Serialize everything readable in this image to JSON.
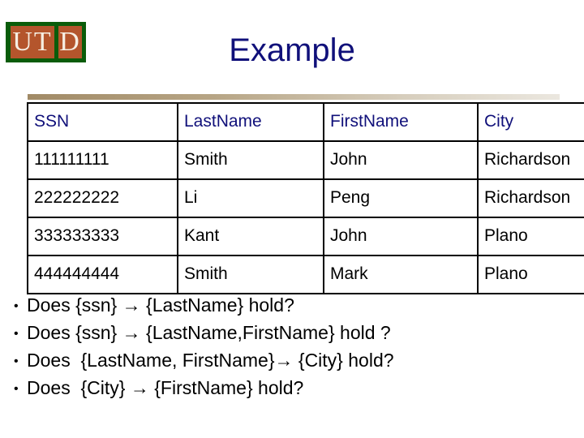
{
  "logo": {
    "name": "utd-logo",
    "tiles": [
      {
        "text": "U T",
        "letters": [
          "U",
          "T"
        ]
      },
      {
        "text": "D",
        "letters": [
          "D"
        ]
      }
    ],
    "letter_u": "U",
    "letter_t": "T",
    "letter_d": "D",
    "frame_color": "#0a5c0a",
    "tile_color": "#b4552c",
    "letter_color": "#f6eee2"
  },
  "header": {
    "title": "Example",
    "title_color": "#10107a"
  },
  "accent_bar": {
    "gradient_start": "#a18a66",
    "gradient_end": "#ebe7df"
  },
  "table": {
    "header_color": "#10107a",
    "body_color": "#000000",
    "columns": [
      "SSN",
      "LastName",
      "FirstName",
      "City"
    ],
    "rows": [
      {
        "ssn": "111111111",
        "last_name": "Smith",
        "first_name": "John",
        "city": "Richardson"
      },
      {
        "ssn": "222222222",
        "last_name": "Li",
        "first_name": "Peng",
        "city": "Richardson"
      },
      {
        "ssn": "333333333",
        "last_name": "Kant",
        "first_name": "John",
        "city": "Plano"
      },
      {
        "ssn": "444444444",
        "last_name": "Smith",
        "first_name": "Mark",
        "city": "Plano"
      }
    ]
  },
  "questions": {
    "bullet_glyph": "•",
    "items": [
      {
        "text": "Does {ssn} → {LastName} hold?"
      },
      {
        "text": "Does {ssn} → {LastName,FirstName} hold ?"
      },
      {
        "text": "Does  {LastName, FirstName}→ {City} hold?"
      },
      {
        "text": "Does  {City} → {FirstName} hold?"
      }
    ]
  }
}
